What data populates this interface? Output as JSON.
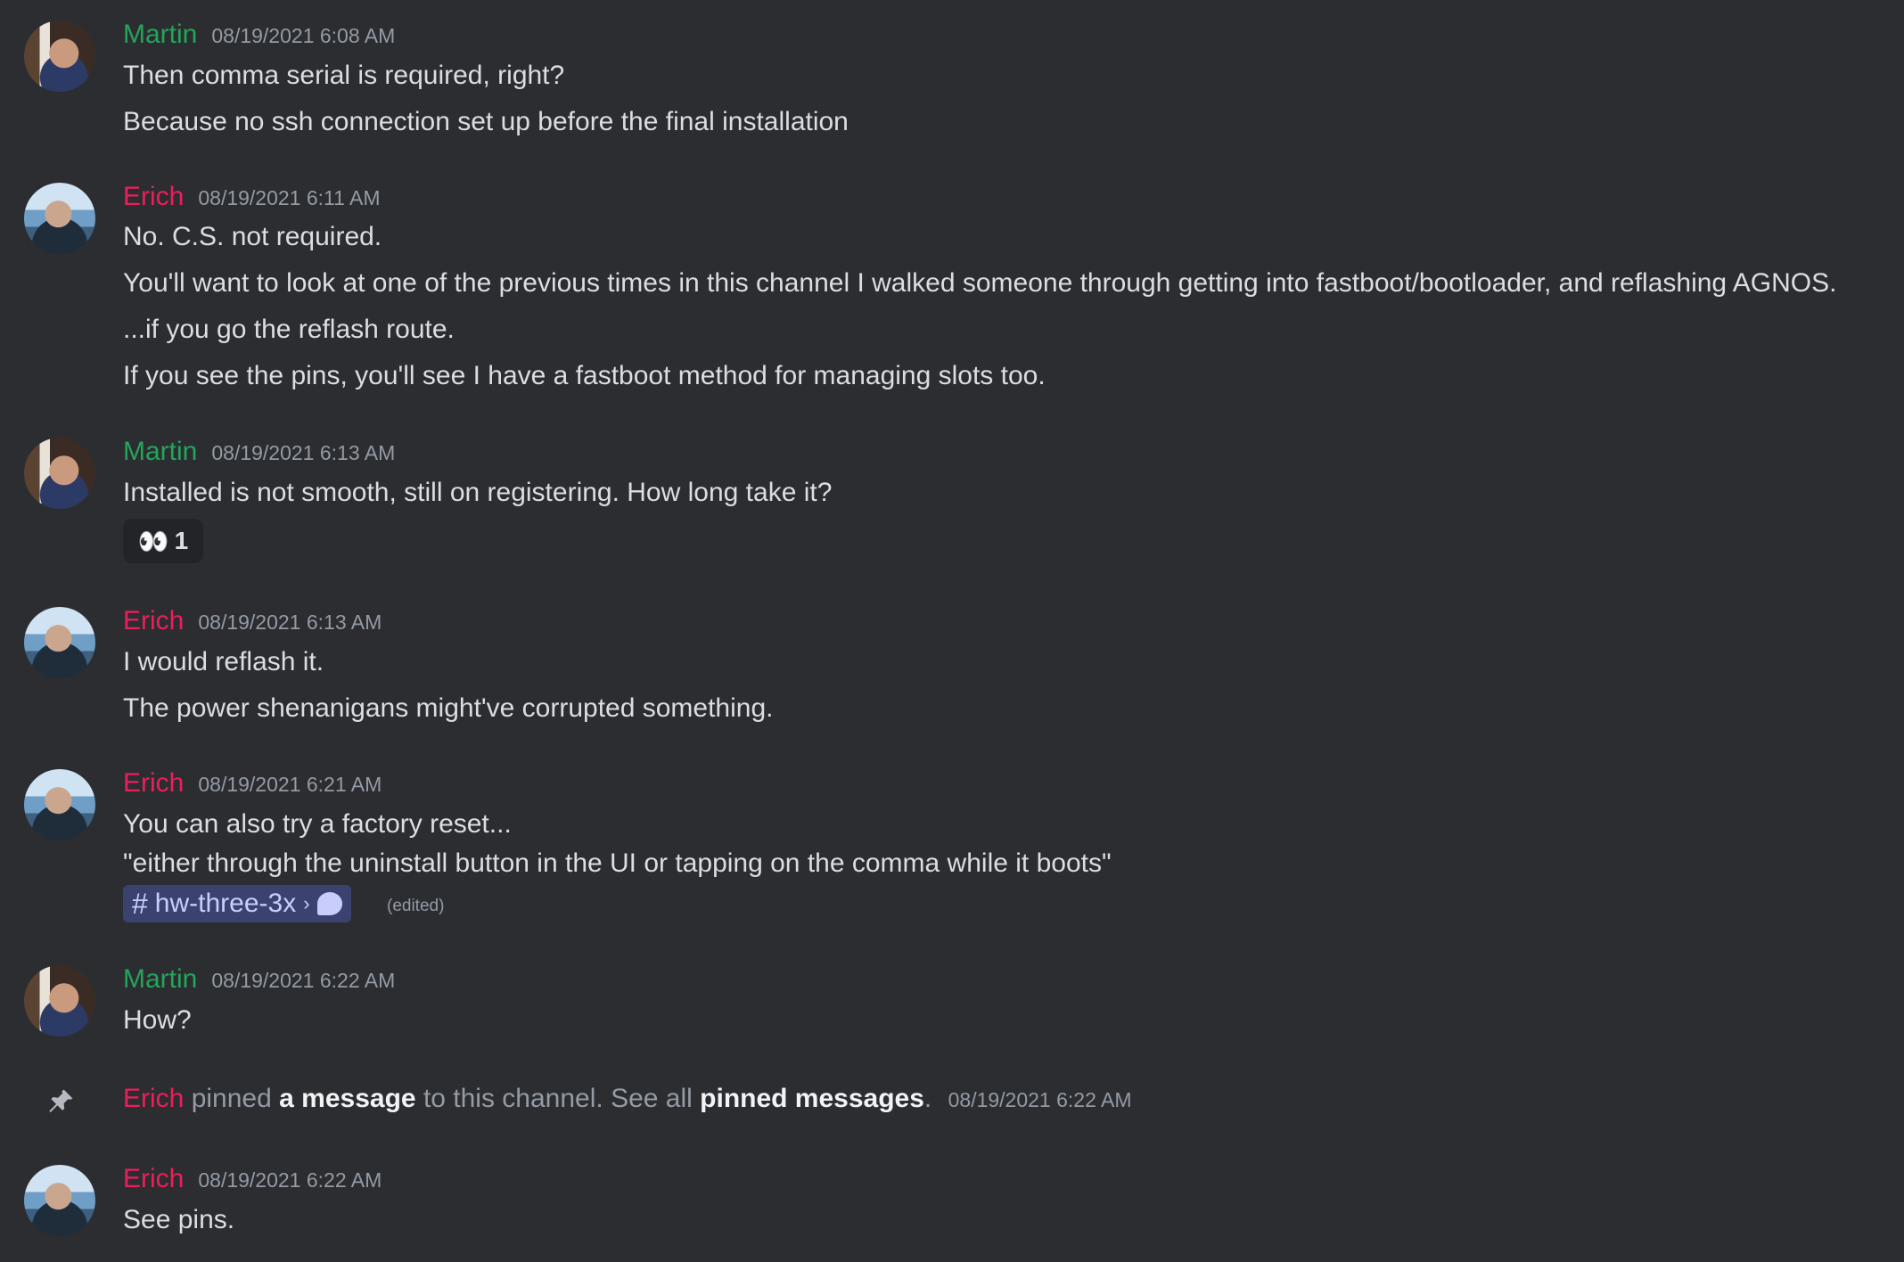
{
  "colors": {
    "background": "#2b2d31",
    "martin_name": "#23a55a",
    "erich_name": "#ed1e5a",
    "timestamp": "#949ba4",
    "channel_pill_bg": "#3c4270"
  },
  "messages": [
    {
      "author": "Martin",
      "timestamp": "08/19/2021 6:08 AM",
      "lines": [
        "Then comma serial is required, right?",
        "Because no ssh connection set up before the final installation"
      ]
    },
    {
      "author": "Erich",
      "timestamp": "08/19/2021 6:11 AM",
      "lines": [
        "No.  C.S. not required.",
        "You'll want to look at one of the previous times in this channel I walked someone through getting into fastboot/bootloader, and reflashing AGNOS.",
        "...if you go the reflash route.",
        "If you see the pins, you'll see I have a fastboot method for managing slots too."
      ]
    },
    {
      "author": "Martin",
      "timestamp": "08/19/2021 6:13 AM",
      "lines": [
        "Installed is not smooth, still on registering. How long take it?"
      ],
      "reaction": {
        "emoji": "👀",
        "count": "1"
      }
    },
    {
      "author": "Erich",
      "timestamp": "08/19/2021 6:13 AM",
      "lines": [
        "I would reflash it.",
        "The power shenanigans might've corrupted something."
      ]
    },
    {
      "author": "Erich",
      "timestamp": "08/19/2021 6:21 AM",
      "lines": [
        "You can also try a factory reset...",
        "\"either through the uninstall button in the UI or tapping on the comma while it boots\""
      ],
      "channel_link": {
        "hash": "#",
        "name": "hw-three-3x",
        "arrow": "›"
      },
      "edited": "(edited)"
    },
    {
      "author": "Martin",
      "timestamp": "08/19/2021 6:22 AM",
      "lines": [
        "How?"
      ]
    },
    {
      "author": "Erich",
      "timestamp": "08/19/2021 6:22 AM",
      "lines": [
        "See pins."
      ]
    }
  ],
  "system_pin": {
    "icon": "pin-icon",
    "author": "Erich",
    "text1": "pinned",
    "link1": "a message",
    "text2": "to this channel. See all",
    "link2": "pinned messages",
    "text3": ".",
    "timestamp": "08/19/2021 6:22 AM"
  }
}
